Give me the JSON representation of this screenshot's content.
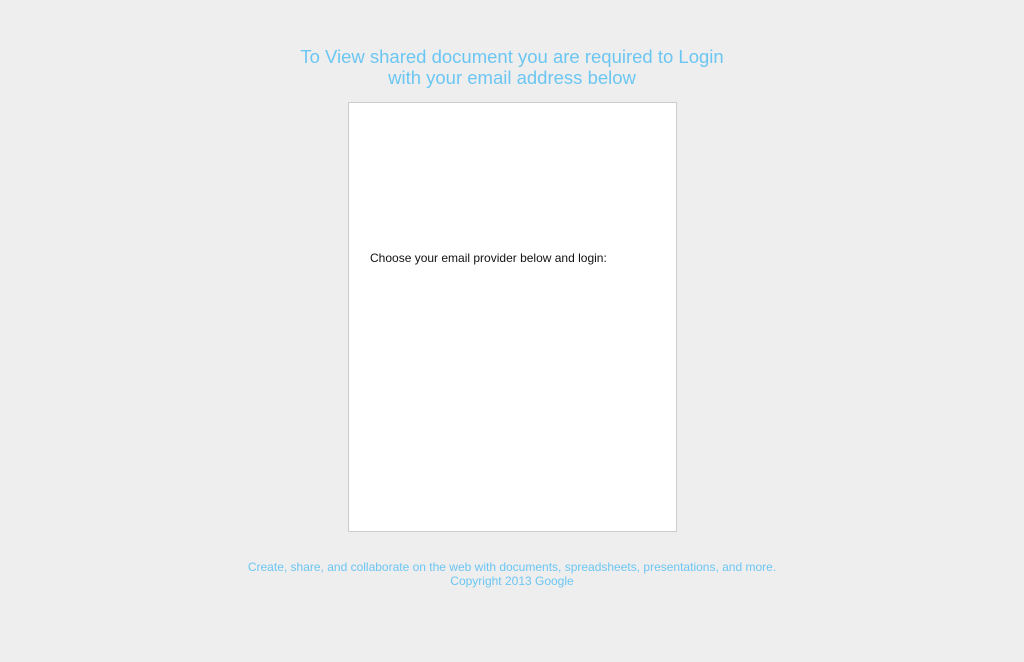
{
  "heading": {
    "line1": "To View shared document you are required to Login",
    "line2": "with your email address below"
  },
  "card": {
    "prompt": "Choose your email provider below and login:"
  },
  "footer": {
    "tagline": "Create, share, and collaborate on the web with documents, spreadsheets, presentations, and more.",
    "copyright": "Copyright 2013 Google"
  },
  "colors": {
    "accent": "#6cc6f2",
    "background": "#eeeeee",
    "card": "#ffffff",
    "card_border": "#cccccc"
  }
}
